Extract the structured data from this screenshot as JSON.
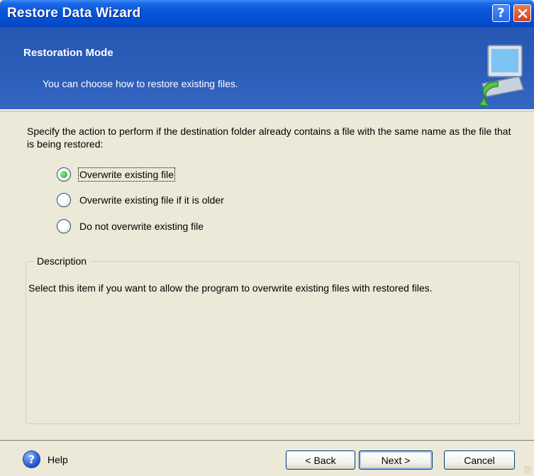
{
  "window": {
    "title": "Restore Data Wizard"
  },
  "header": {
    "title": "Restoration Mode",
    "subtitle": "You can choose how to restore existing files."
  },
  "content": {
    "instruction": "Specify the action to perform if the destination folder already contains a file with the same name as the file that is being restored:",
    "options": [
      {
        "label": "Overwrite existing file",
        "selected": true
      },
      {
        "label": "Overwrite existing file if it is older",
        "selected": false
      },
      {
        "label": "Do not overwrite existing file",
        "selected": false
      }
    ],
    "description": {
      "legend": "Description",
      "text": "Select this item if you want to allow the program to overwrite existing files with restored files."
    }
  },
  "footer": {
    "help": "Help",
    "back": "< Back",
    "next": "Next >",
    "cancel": "Cancel"
  },
  "icons": {
    "help_title": "question-mark-icon",
    "close_title": "close-x-icon",
    "header": "computer-restore-arrow-icon",
    "help_footer": "help-question-icon"
  },
  "colors": {
    "titlebar": "#0A56DA",
    "header_band": "#2A5CB8",
    "dialog_bg": "#ECE9D8",
    "radio_selected": "#21A121"
  }
}
